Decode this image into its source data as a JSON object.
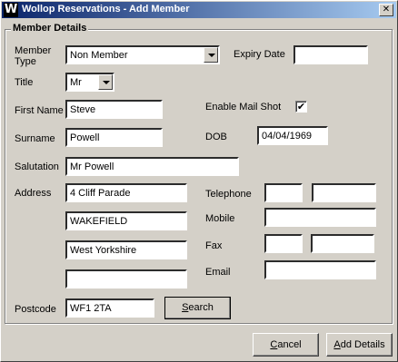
{
  "window": {
    "title": "Wollop Reservations - Add Member",
    "logo_letter": "W",
    "close_glyph": "✕"
  },
  "group": {
    "legend": "Member Details"
  },
  "labels": {
    "member_type_line1": "Member",
    "member_type_line2": "Type",
    "expiry_date": "Expiry Date",
    "title": "Title",
    "first_name": "First Name",
    "enable_mail_shot": "Enable Mail Shot",
    "surname": "Surname",
    "dob": "DOB",
    "salutation": "Salutation",
    "address": "Address",
    "telephone": "Telephone",
    "mobile": "Mobile",
    "fax": "Fax",
    "email": "Email",
    "postcode": "Postcode"
  },
  "fields": {
    "member_type": "Non Member",
    "expiry_date": "",
    "title": "Mr",
    "first_name": "Steve",
    "enable_mail_shot": "✔",
    "surname": "Powell",
    "dob": "04/04/1969",
    "salutation": "Mr Powell",
    "address1": "4 Cliff Parade",
    "address2": "WAKEFIELD",
    "address3": "West Yorkshire",
    "address4": "",
    "telephone_code": "",
    "telephone_number": "",
    "mobile": "",
    "fax_code": "",
    "fax_number": "",
    "email": "",
    "postcode": "WF1 2TA"
  },
  "buttons": {
    "search_first": "S",
    "search_rest": "earch",
    "cancel_first": "C",
    "cancel_rest": "ancel",
    "add_first": "A",
    "add_rest": "dd Details"
  }
}
